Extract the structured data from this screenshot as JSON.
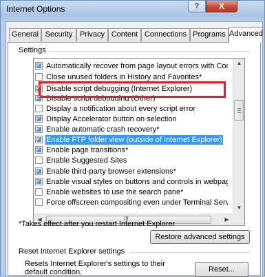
{
  "window": {
    "title": "Internet Options",
    "help_label": "?",
    "close_label": "X"
  },
  "tabs": [
    {
      "label": "General"
    },
    {
      "label": "Security"
    },
    {
      "label": "Privacy"
    },
    {
      "label": "Content"
    },
    {
      "label": "Connections"
    },
    {
      "label": "Programs"
    },
    {
      "label": "Advanced",
      "active": true
    }
  ],
  "settings": {
    "group_label": "Settings",
    "items": [
      {
        "label": "Automatically recover from page layout errors with Compa",
        "checked": true
      },
      {
        "label": "Close unused folders in History and Favorites*",
        "checked": false
      },
      {
        "label": "Disable script debugging (Internet Explorer)",
        "checked": true
      },
      {
        "label": "Disable script debugging (Other)",
        "checked": true
      },
      {
        "label": "Display a notification about every script error",
        "checked": false
      },
      {
        "label": "Display Accelerator button on selection",
        "checked": true
      },
      {
        "label": "Enable automatic crash recovery*",
        "checked": true
      },
      {
        "label": "Enable FTP folder view (outside of Internet Explorer)",
        "checked": true,
        "selected": true
      },
      {
        "label": "Enable page transitions*",
        "checked": true
      },
      {
        "label": "Enable Suggested Sites",
        "checked": false
      },
      {
        "label": "Enable third-party browser extensions*",
        "checked": true
      },
      {
        "label": "Enable visual styles on buttons and controls in webpages",
        "checked": true
      },
      {
        "label": "Enable websites to use the search pane*",
        "checked": false
      },
      {
        "label": "Force offscreen compositing even under Terminal Server*",
        "checked": false
      }
    ],
    "scroll_up": "▲",
    "scroll_down": "▼",
    "scroll_left": "◀",
    "scroll_right": "▶",
    "hthumb_grip": "III"
  },
  "footnote": "*Takes effect after you restart Internet Explorer",
  "restore_button": "Restore advanced settings",
  "reset_section": {
    "label": "Reset Internet Explorer settings",
    "description": "Resets Internet Explorer's settings to their default condition.",
    "button": "Reset..."
  }
}
